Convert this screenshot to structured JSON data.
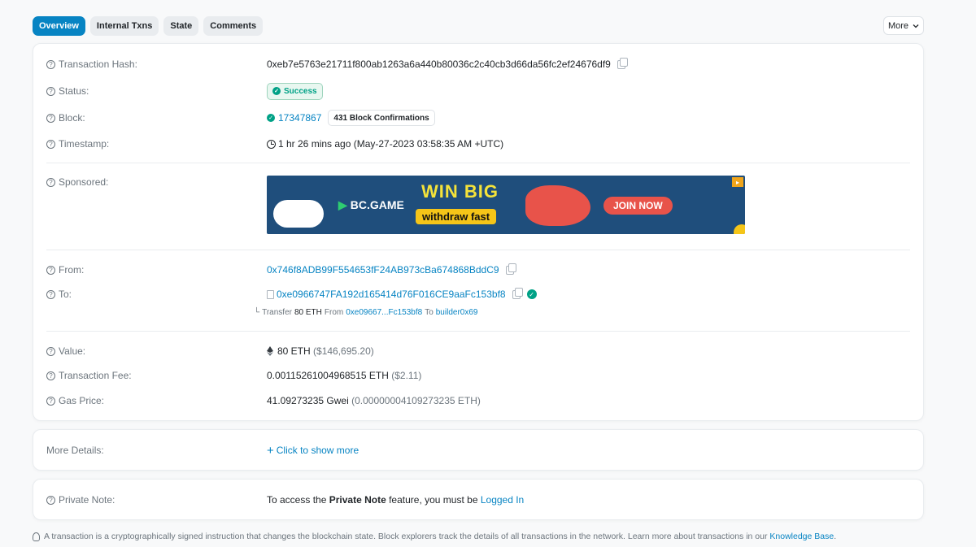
{
  "tabs": [
    {
      "label": "Overview",
      "active": true
    },
    {
      "label": "Internal Txns",
      "active": false
    },
    {
      "label": "State",
      "active": false
    },
    {
      "label": "Comments",
      "active": false
    }
  ],
  "more_button": {
    "label": "More"
  },
  "details": {
    "tx_hash": {
      "label": "Transaction Hash:",
      "value": "0xeb7e5763e21711f800ab1263a6a440b80036c2c40cb3d66da56fc2ef24676df9"
    },
    "status": {
      "label": "Status:",
      "value": "Success"
    },
    "block": {
      "label": "Block:",
      "value": "17347867",
      "confirmations": "431 Block Confirmations"
    },
    "timestamp": {
      "label": "Timestamp:",
      "value": "1 hr 26 mins ago (May-27-2023 03:58:35 AM +UTC)"
    },
    "sponsored": {
      "label": "Sponsored:",
      "ad": {
        "brand": "BC.GAME",
        "headline": "WIN BIG",
        "tagline": "withdraw fast",
        "cta": "JOIN NOW"
      }
    },
    "from": {
      "label": "From:",
      "value": "0x746f8ADB99F554653fF24AB973cBa674868BddC9"
    },
    "to": {
      "label": "To:",
      "value": "0xe0966747FA192d165414d76F016CE9aaFc153bf8",
      "transfer": {
        "prefix": "Transfer",
        "amount": "80 ETH",
        "from_word": "From",
        "from_addr": "0xe09667...Fc153bf8",
        "to_word": "To",
        "to_addr": "builder0x69"
      }
    },
    "value": {
      "label": "Value:",
      "amount": "80 ETH",
      "usd": "($146,695.20)"
    },
    "fee": {
      "label": "Transaction Fee:",
      "amount": "0.00115261004968515 ETH",
      "usd": "($2.11)"
    },
    "gas": {
      "label": "Gas Price:",
      "amount": "41.09273235 Gwei",
      "eth": "(0.00000004109273235 ETH)"
    }
  },
  "more_details": {
    "label": "More Details:",
    "link": "Click to show more"
  },
  "private_note": {
    "label": "Private Note:",
    "text_before": "To access the",
    "bold": "Private Note",
    "text_after": "feature, you must be",
    "link": "Logged In"
  },
  "footer": {
    "text": "A transaction is a cryptographically signed instruction that changes the blockchain state. Block explorers track the details of all transactions in the network. Learn more about transactions in our",
    "link": "Knowledge Base",
    "end": "."
  },
  "colors": {
    "accent": "#0784c3",
    "success": "#00a186"
  }
}
